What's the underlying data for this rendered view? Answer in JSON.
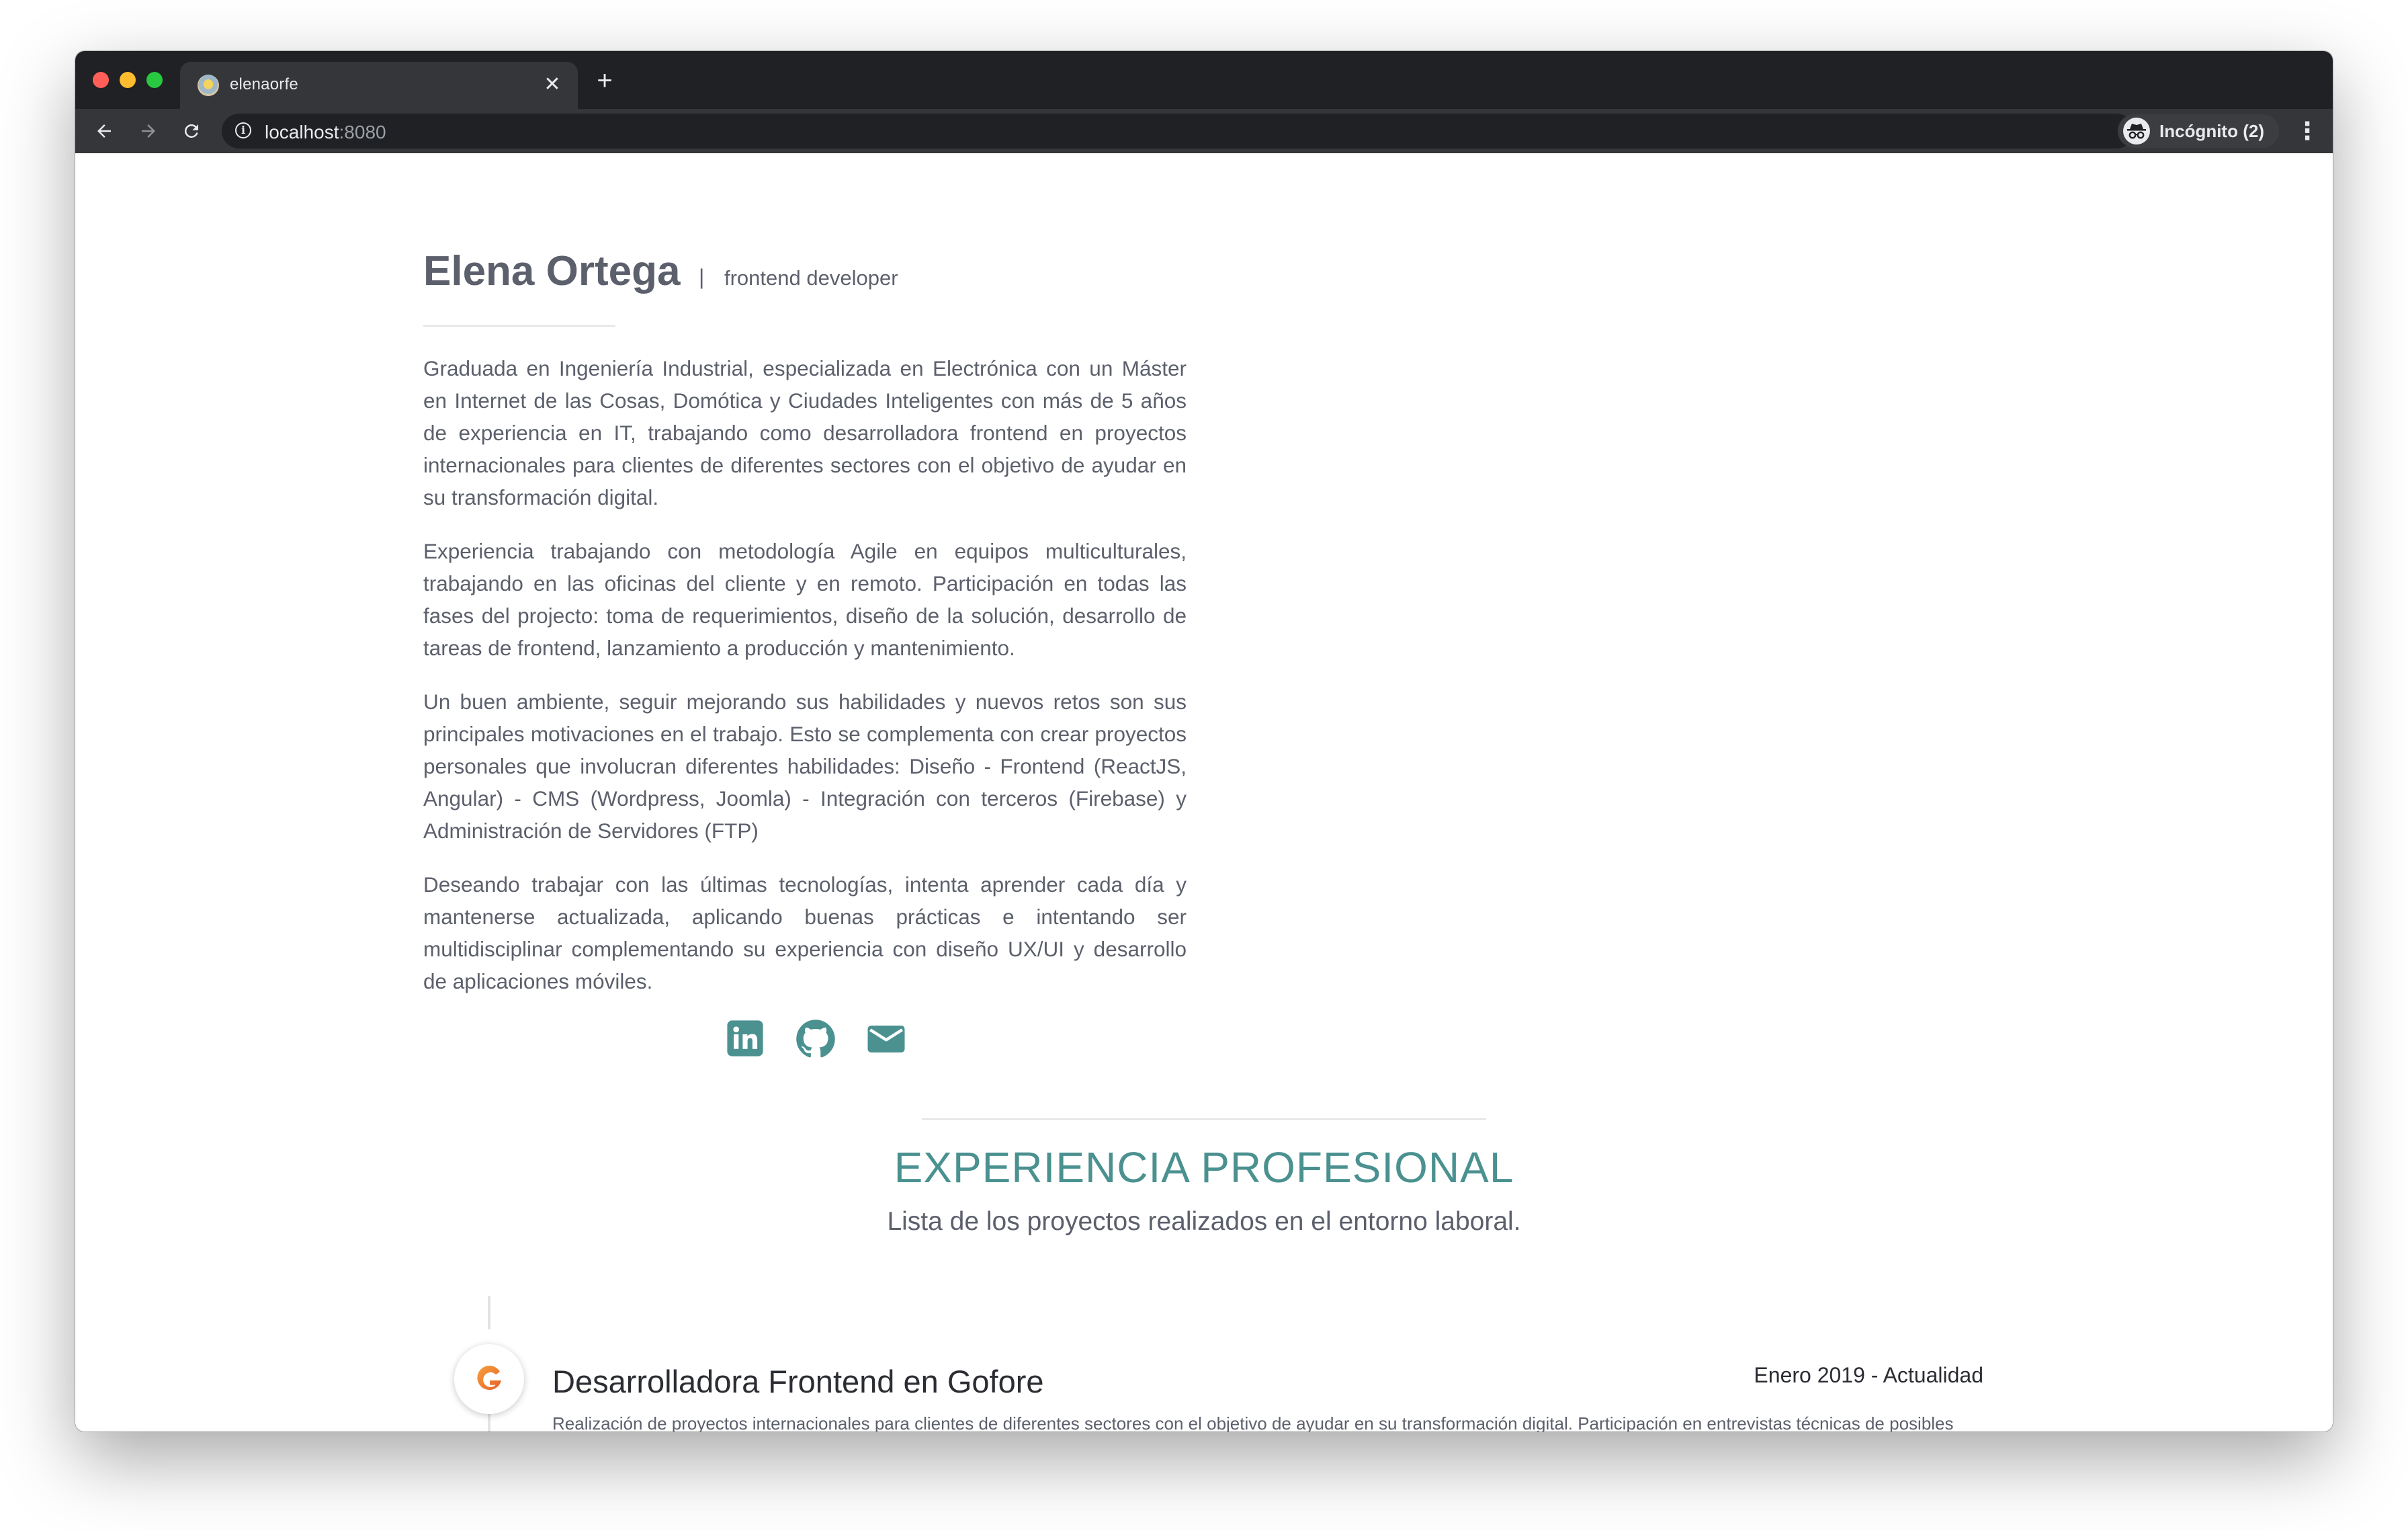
{
  "browser": {
    "tab_title": "elenaorfe",
    "tab_close": "✕",
    "new_tab": "+",
    "url_host": "localhost",
    "url_port": ":8080",
    "incognito_label": "Incógnito (2)",
    "back_icon": "arrow-left-icon",
    "forward_icon": "arrow-right-icon",
    "reload_icon": "reload-icon",
    "bookmark_icon": "star-icon",
    "menu_icon": "vertical-dots-icon"
  },
  "profile": {
    "name": "Elena Ortega",
    "separator": "|",
    "role": "frontend developer",
    "bio": [
      "Graduada en Ingeniería Industrial, especializada en Electrónica con un Máster en Internet de las Cosas, Domótica y Ciudades Inteligentes con más de 5 años de experiencia en IT, trabajando como desarrolladora frontend en proyectos internacionales para clientes de diferentes sectores con el objetivo de ayudar en su transformación digital.",
      "Experiencia trabajando con metodología Agile en equipos multiculturales, trabajando en las oficinas del cliente y en remoto. Participación en todas las fases del projecto: toma de requerimientos, diseño de la solución, desarrollo de tareas de frontend, lanzamiento a producción y mantenimiento.",
      "Un buen ambiente, seguir mejorando sus habilidades y nuevos retos son sus principales motivaciones en el trabajo. Esto se complementa con crear proyectos personales que involucran diferentes habilidades: Diseño - Frontend (ReactJS, Angular) - CMS (Wordpress, Joomla) - Integración con terceros (Firebase) y Administración de Servidores (FTP)",
      "Deseando trabajar con las últimas tecnologías, intenta aprender cada día y mantenerse actualizada, aplicando buenas prácticas e intentando ser multidisciplinar complementando su experiencia con diseño UX/UI y desarrollo de aplicaciones móviles."
    ],
    "social_icons": [
      "linkedin-icon",
      "github-icon",
      "mail-icon"
    ],
    "accent_color": "#4a9190"
  },
  "experience": {
    "title": "EXPERIENCIA PROFESIONAL",
    "subtitle": "Lista de los proyectos realizados en el entorno laboral.",
    "jobs": [
      {
        "logo_icon": "gofore-logo-icon",
        "title": "Desarrolladora Frontend en Gofore",
        "date": "Enero 2019 - Actualidad",
        "description": "Realización de proyectos internacionales para clientes de diferentes sectores con el objetivo de ayudar en su transformación digital. Participación en entrevistas técnicas de posibles candidatos. Análisis y documentación de licitaciones europeas."
      }
    ]
  }
}
